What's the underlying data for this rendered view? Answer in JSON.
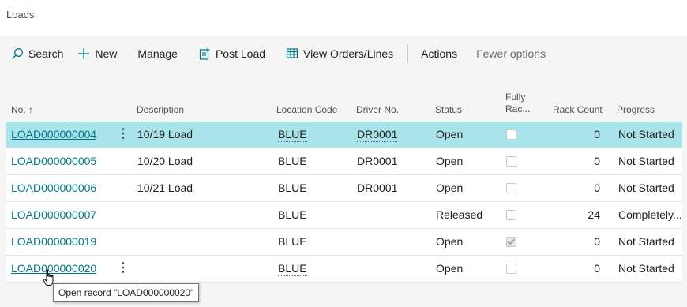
{
  "page": {
    "title": "Loads"
  },
  "actions": [
    {
      "label": "Search",
      "icon": "search-icon"
    },
    {
      "label": "New",
      "icon": "plus-icon"
    },
    {
      "label": "Manage"
    },
    {
      "label": "Post Load",
      "icon": "post-document-icon"
    },
    {
      "label": "View Orders/Lines",
      "icon": "grid-view-icon"
    },
    {
      "label": "Actions"
    },
    {
      "label": "Fewer options"
    }
  ],
  "columns": {
    "no": "No. ↑",
    "description": "Description",
    "location": "Location Code",
    "driver": "Driver No.",
    "status": "Status",
    "fully_rack_1": "Fully",
    "fully_rack_2": "Rac...",
    "rack_count": "Rack Count",
    "progress": "Progress"
  },
  "rows": [
    {
      "no": "LOAD000000004",
      "description": "10/19 Load",
      "location": "BLUE",
      "driver": "DR0001",
      "status": "Open",
      "fully_racked": false,
      "rack_count": "0",
      "progress": "Not Started"
    },
    {
      "no": "LOAD000000005",
      "description": "10/20 Load",
      "location": "BLUE",
      "driver": "DR0001",
      "status": "Open",
      "fully_racked": false,
      "rack_count": "0",
      "progress": "Not Started"
    },
    {
      "no": "LOAD000000006",
      "description": "10/21 Load",
      "location": "BLUE",
      "driver": "DR0001",
      "status": "Open",
      "fully_racked": false,
      "rack_count": "0",
      "progress": "Not Started"
    },
    {
      "no": "LOAD000000007",
      "description": "",
      "location": "BLUE",
      "driver": "",
      "status": "Released",
      "fully_racked": false,
      "rack_count": "24",
      "progress": "Completely..."
    },
    {
      "no": "LOAD000000019",
      "description": "",
      "location": "BLUE",
      "driver": "",
      "status": "Open",
      "fully_racked": true,
      "rack_count": "0",
      "progress": "Not Started"
    },
    {
      "no": "LOAD000000020",
      "description": "",
      "location": "BLUE",
      "driver": "",
      "status": "Open",
      "fully_racked": false,
      "rack_count": "0",
      "progress": "Not Started"
    }
  ],
  "tooltip": "Open record \"LOAD000000020\"",
  "colors": {
    "selected_row": "#a9e4ea",
    "link": "#00788a",
    "background": "#f5f5f5"
  }
}
